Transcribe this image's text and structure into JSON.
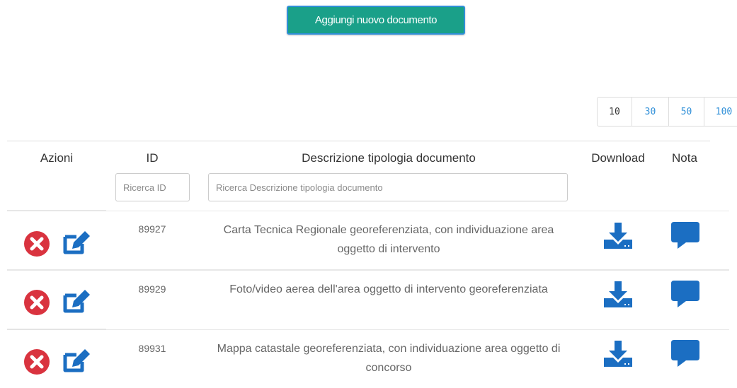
{
  "toolbar": {
    "add_label": "Aggiungi nuovo documento"
  },
  "pager": {
    "sizes": [
      "10",
      "30",
      "50",
      "100"
    ],
    "active": "10"
  },
  "table": {
    "headers": {
      "actions": "Azioni",
      "id": "ID",
      "description": "Descrizione tipologia documento",
      "download": "Download",
      "note": "Nota"
    },
    "filters": {
      "id_placeholder": "Ricerca ID",
      "description_placeholder": "Ricerca Descrizione tipologia documento"
    },
    "rows": [
      {
        "id": "89927",
        "description": "Carta Tecnica Regionale georeferenziata, con individuazione area oggetto di intervento"
      },
      {
        "id": "89929",
        "description": "Foto/video aerea dell'area oggetto di intervento georeferenziata"
      },
      {
        "id": "89931",
        "description": "Mappa catastale georeferenziata, con individuazione area oggetto di concorso"
      }
    ]
  },
  "icons": {
    "delete": "delete-circle-icon",
    "edit": "edit-icon",
    "download": "download-icon",
    "note": "comment-icon"
  },
  "colors": {
    "primary_button": "#1aa089",
    "link_blue": "#2f8fd8",
    "icon_blue": "#1b6ec2",
    "delete_red": "#d9333f"
  }
}
